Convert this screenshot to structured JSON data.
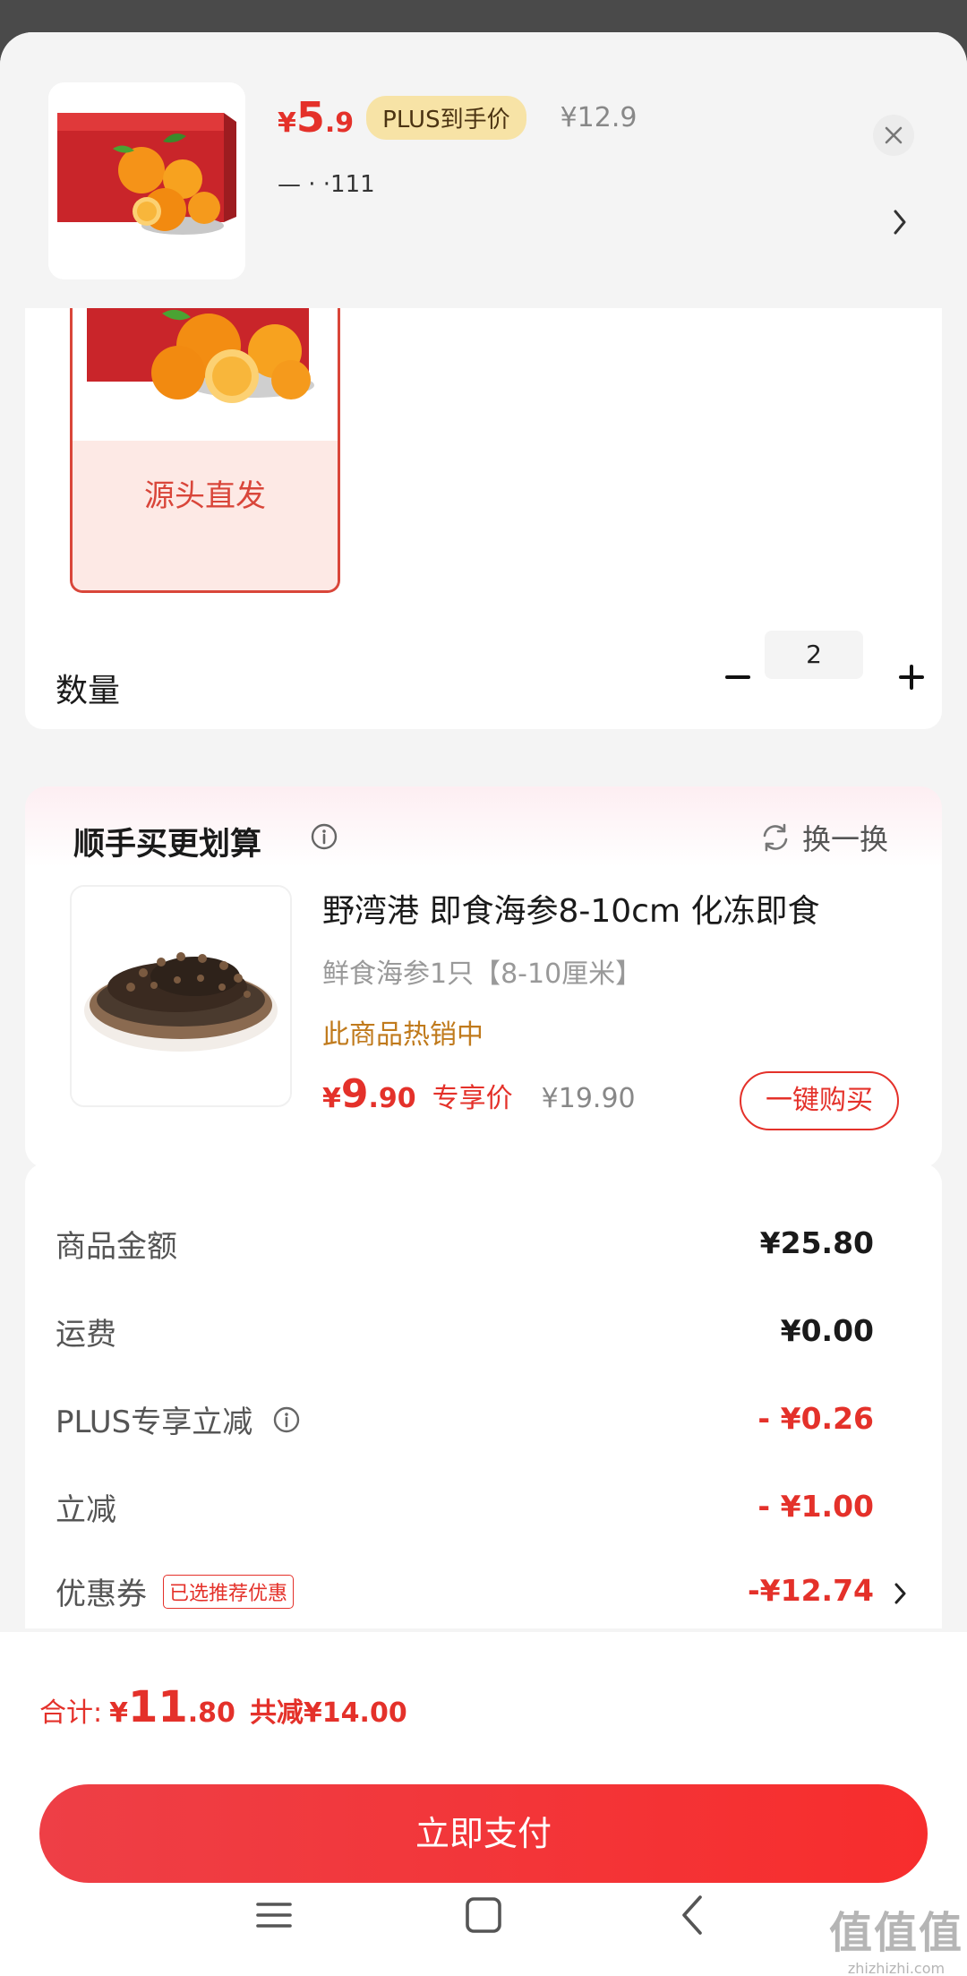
{
  "header": {
    "price_yen": "¥",
    "price_int": "5",
    "price_dec": ".9",
    "plus_badge": "PLUS到手价",
    "orig_price": "¥12.9",
    "spec_text": "—   · ·111"
  },
  "sku": {
    "option_label": "源头直发",
    "qty_title": "数量",
    "qty_value": "2"
  },
  "upsell": {
    "title": "顺手买更划算",
    "swap_label": "换一换",
    "name": "野湾港 即食海参8-10cm 化冻即食",
    "spec": "鲜食海参1只【8-10厘米】",
    "hot": "此商品热销中",
    "price_yen": "¥",
    "price_int": "9",
    "price_dec": ".90",
    "price_tag": "专享价",
    "orig_price": "¥19.90",
    "buy_label": "一键购买"
  },
  "summary": {
    "rows": [
      {
        "label": "商品金额",
        "value": "¥25.80"
      },
      {
        "label": "运费",
        "value": "¥0.00"
      },
      {
        "label": "PLUS专享立减",
        "value": "- ¥0.26"
      },
      {
        "label": "立减",
        "value": "- ¥1.00"
      },
      {
        "label": "优惠券",
        "value": "-¥12.74",
        "tag": "已选推荐优惠"
      }
    ]
  },
  "bottom": {
    "total_label": "合计:",
    "total_yen": "¥",
    "total_int": "11",
    "total_dec": ".80",
    "saved": "共减¥14.00",
    "pay_label": "立即支付"
  },
  "watermark": {
    "glyphs": "值值值",
    "url": "zhizhizhi.com"
  },
  "colors": {
    "accent": "#e4312a",
    "plus_badge_bg": "#f7e3a6",
    "hot_text": "#c07a1c"
  }
}
